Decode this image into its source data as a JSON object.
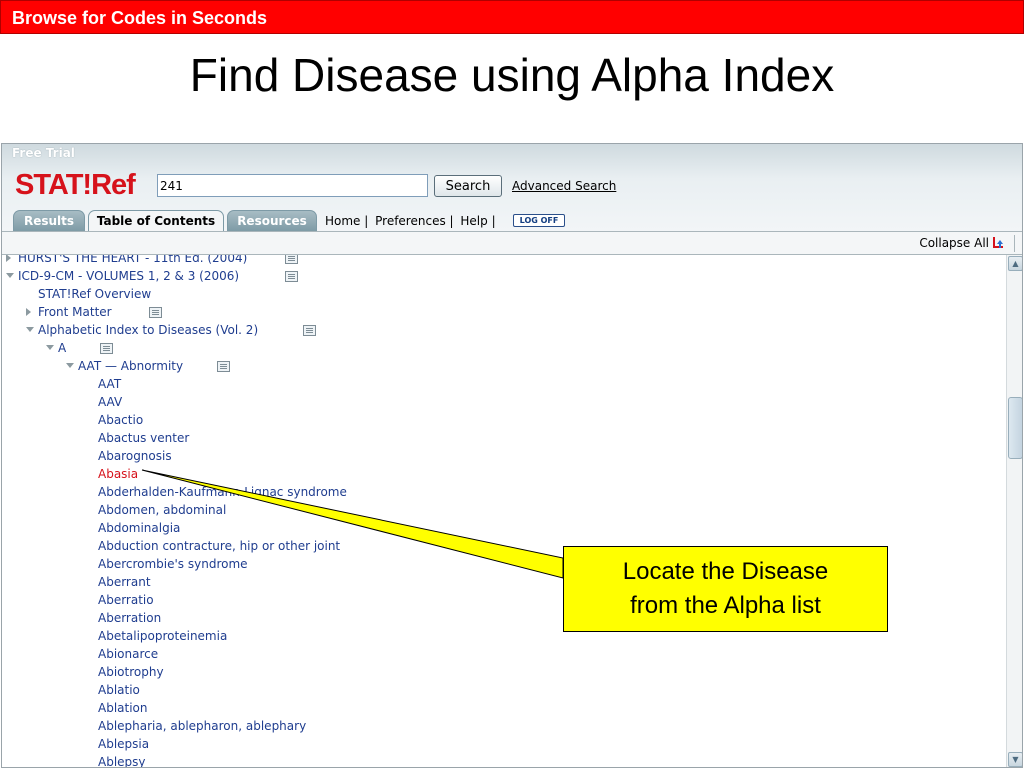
{
  "banner": {
    "title": "Browse for Codes in Seconds"
  },
  "slide_title": "Find Disease using Alpha Index",
  "app": {
    "free_trial": "Free Trial",
    "logo": "STAT!Ref",
    "search": {
      "value": "241",
      "button_label": "Search",
      "advanced_label": "Advanced Search"
    },
    "tabs": [
      {
        "label": "Results",
        "active": false
      },
      {
        "label": "Table of Contents",
        "active": true
      },
      {
        "label": "Resources",
        "active": false
      }
    ],
    "nav_links": [
      "Home |",
      "Preferences |",
      "Help |"
    ],
    "logoff_label": "LOG OFF",
    "toolbar": {
      "collapse_label": "Collapse All"
    },
    "tree": [
      {
        "label": "HURST'S THE HEART - 11th Ed. (2004)",
        "level": 0,
        "toggle": "right",
        "doc": true
      },
      {
        "label": "ICD-9-CM - VOLUMES 1, 2 & 3 (2006)",
        "level": 0,
        "toggle": "down",
        "doc": true
      },
      {
        "label": "STAT!Ref Overview",
        "level": 1,
        "toggle": "none",
        "doc": false
      },
      {
        "label": "Front Matter",
        "level": 1,
        "toggle": "right",
        "doc": true
      },
      {
        "label": "Alphabetic Index to Diseases (Vol. 2)",
        "level": 1,
        "toggle": "down",
        "doc": true
      },
      {
        "label": "A",
        "level": 2,
        "toggle": "down",
        "doc": true
      },
      {
        "label": "AAT — Abnormity",
        "level": 3,
        "toggle": "down",
        "doc": true
      },
      {
        "label": "AAT",
        "level": 4,
        "toggle": "none",
        "doc": false
      },
      {
        "label": "AAV",
        "level": 4,
        "toggle": "none",
        "doc": false
      },
      {
        "label": "Abactio",
        "level": 4,
        "toggle": "none",
        "doc": false
      },
      {
        "label": "Abactus venter",
        "level": 4,
        "toggle": "none",
        "doc": false
      },
      {
        "label": "Abarognosis",
        "level": 4,
        "toggle": "none",
        "doc": false
      },
      {
        "label": "Abasia",
        "level": 4,
        "toggle": "none",
        "doc": false,
        "highlight": true
      },
      {
        "label": "Abderhalden-Kaufmann-Lignac syndrome",
        "level": 4,
        "toggle": "none",
        "doc": false
      },
      {
        "label": "Abdomen, abdominal",
        "level": 4,
        "toggle": "none",
        "doc": false
      },
      {
        "label": "Abdominalgia",
        "level": 4,
        "toggle": "none",
        "doc": false
      },
      {
        "label": "Abduction contracture, hip or other joint",
        "level": 4,
        "toggle": "none",
        "doc": false
      },
      {
        "label": "Abercrombie's syndrome",
        "level": 4,
        "toggle": "none",
        "doc": false
      },
      {
        "label": "Aberrant",
        "level": 4,
        "toggle": "none",
        "doc": false
      },
      {
        "label": "Aberratio",
        "level": 4,
        "toggle": "none",
        "doc": false
      },
      {
        "label": "Aberration",
        "level": 4,
        "toggle": "none",
        "doc": false
      },
      {
        "label": "Abetalipoproteinemia",
        "level": 4,
        "toggle": "none",
        "doc": false
      },
      {
        "label": "Abionarce",
        "level": 4,
        "toggle": "none",
        "doc": false
      },
      {
        "label": "Abiotrophy",
        "level": 4,
        "toggle": "none",
        "doc": false
      },
      {
        "label": "Ablatio",
        "level": 4,
        "toggle": "none",
        "doc": false
      },
      {
        "label": "Ablation",
        "level": 4,
        "toggle": "none",
        "doc": false
      },
      {
        "label": "Ablepharia, ablepharon, ablephary",
        "level": 4,
        "toggle": "none",
        "doc": false
      },
      {
        "label": "Ablepsia",
        "level": 4,
        "toggle": "none",
        "doc": false
      },
      {
        "label": "Ablepsy",
        "level": 4,
        "toggle": "none",
        "doc": false
      }
    ]
  },
  "callout": {
    "line1": "Locate the Disease",
    "line2": "from the Alpha list"
  },
  "colors": {
    "banner": "#ff0000",
    "link": "#1f3d8f",
    "highlight": "#d6121b",
    "callout": "#ffff00",
    "logo": "#d6121b"
  }
}
